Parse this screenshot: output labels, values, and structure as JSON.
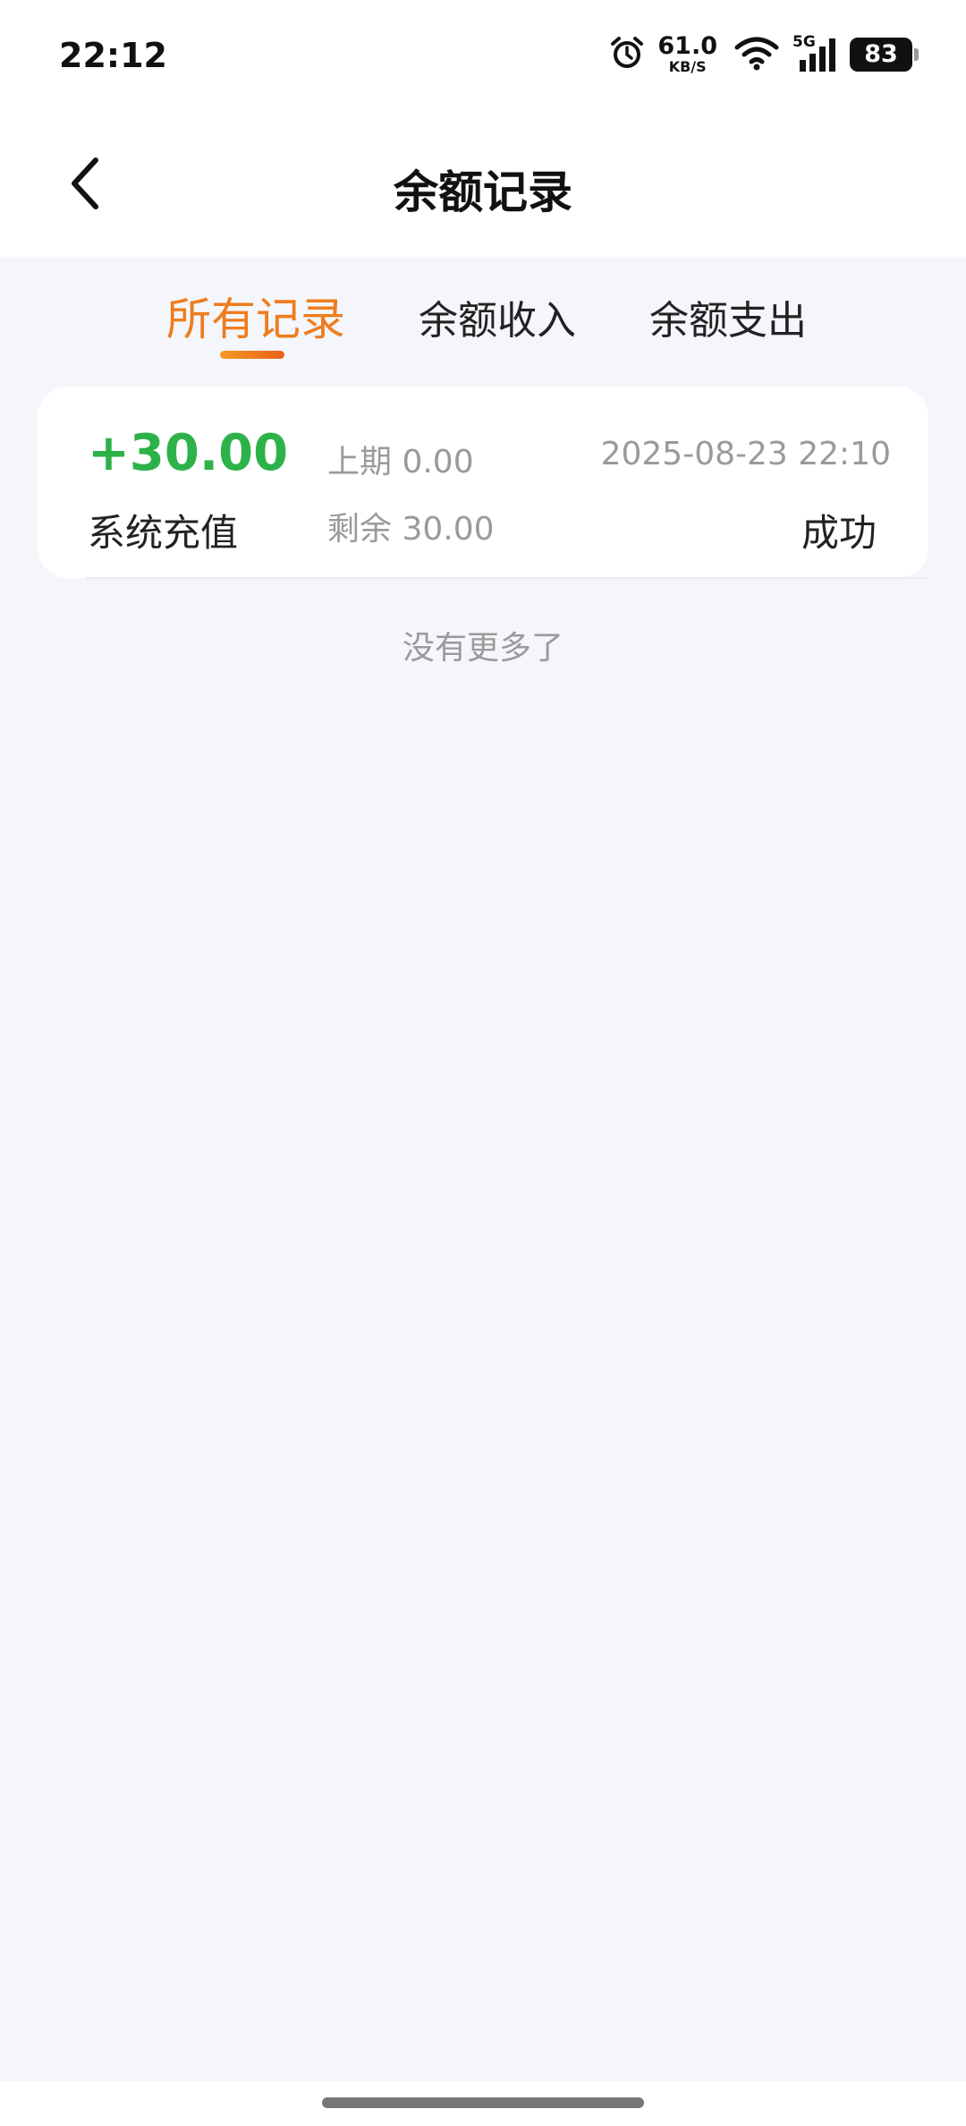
{
  "status_bar": {
    "time": "22:12",
    "net_speed_value": "61.0",
    "net_speed_unit": "KB/S",
    "network_type": "5G",
    "battery_level": "83",
    "icons": [
      "alarm-icon",
      "wifi-icon",
      "signal-icon",
      "battery-icon"
    ]
  },
  "header": {
    "title": "余额记录",
    "back_icon": "chevron-left-icon"
  },
  "tabs": {
    "items": [
      {
        "label": "所有记录",
        "active": true
      },
      {
        "label": "余额收入",
        "active": false
      },
      {
        "label": "余额支出",
        "active": false
      }
    ],
    "active_color": "#ee7d1e"
  },
  "records": [
    {
      "amount": "+30.00",
      "type": "系统充值",
      "previous_balance": "上期 0.00",
      "remaining_balance": "剩余 30.00",
      "time": "2025-08-23 22:10",
      "status": "成功",
      "amount_color": "#2db24a"
    }
  ],
  "list_footer": "没有更多了"
}
